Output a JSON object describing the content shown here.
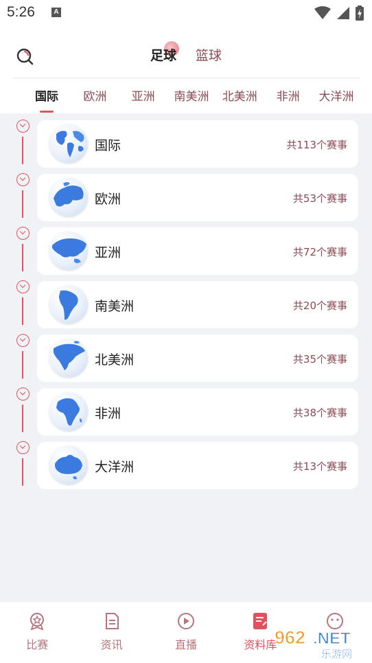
{
  "status_bar": {
    "time": "5:26",
    "notification_letter": "A"
  },
  "sport_tabs": [
    {
      "label": "足球",
      "active": true
    },
    {
      "label": "篮球",
      "active": false
    }
  ],
  "region_tabs": [
    {
      "label": "国际",
      "active": true
    },
    {
      "label": "欧洲",
      "active": false
    },
    {
      "label": "亚洲",
      "active": false
    },
    {
      "label": "南美洲",
      "active": false
    },
    {
      "label": "北美洲",
      "active": false
    },
    {
      "label": "非洲",
      "active": false
    },
    {
      "label": "大洋洲",
      "active": false
    }
  ],
  "regions": [
    {
      "name": "国际",
      "count": "共113个赛事",
      "icon": "globe-world-icon"
    },
    {
      "name": "欧洲",
      "count": "共53个赛事",
      "icon": "globe-europe-icon"
    },
    {
      "name": "亚洲",
      "count": "共72个赛事",
      "icon": "globe-asia-icon"
    },
    {
      "name": "南美洲",
      "count": "共20个赛事",
      "icon": "globe-south-america-icon"
    },
    {
      "name": "北美洲",
      "count": "共35个赛事",
      "icon": "globe-north-america-icon"
    },
    {
      "name": "非洲",
      "count": "共38个赛事",
      "icon": "globe-africa-icon"
    },
    {
      "name": "大洋洲",
      "count": "共13个赛事",
      "icon": "globe-oceania-icon"
    }
  ],
  "bottom_nav": [
    {
      "label": "比赛",
      "icon": "trophy-icon",
      "active": false
    },
    {
      "label": "资讯",
      "icon": "document-icon",
      "active": false
    },
    {
      "label": "直播",
      "icon": "play-icon",
      "active": false
    },
    {
      "label": "资料库",
      "icon": "database-book-icon",
      "active": true
    },
    {
      "label": "",
      "icon": "smiley-icon",
      "active": false
    }
  ],
  "watermark": {
    "text_top": "962.NET",
    "text_bottom": "乐游网"
  },
  "colors": {
    "accent": "#e0525d",
    "inactive_text": "#8b4a55",
    "background": "#f1f2f6"
  }
}
